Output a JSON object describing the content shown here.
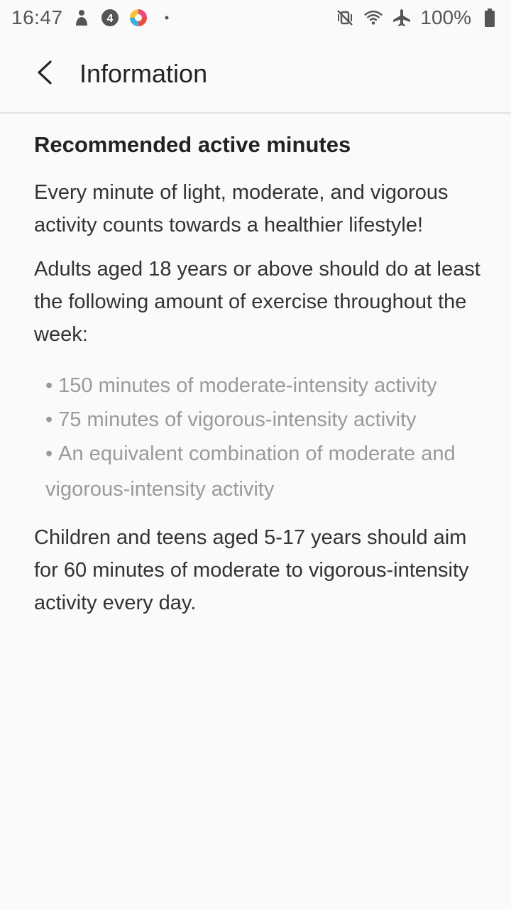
{
  "status_bar": {
    "time": "16:47",
    "battery": "100%",
    "left_icons": [
      "person-icon",
      "badge-4-icon",
      "app-logo-icon",
      "dot-icon"
    ],
    "right_icons": [
      "vibrate-mute-icon",
      "wifi-icon",
      "airplane-icon",
      "battery-icon"
    ]
  },
  "app_bar": {
    "title": "Information"
  },
  "content": {
    "heading": "Recommended active minutes",
    "intro": "Every minute of light, moderate, and vigorous activity counts towards a healthier lifestyle!",
    "adults": "Adults aged 18 years or above should do at least the following amount of exercise throughout the week:",
    "bullets": [
      "150 minutes of moderate-intensity activity",
      "75 minutes of vigorous-intensity activity",
      "An equivalent combination of moderate and vigorous-intensity activity"
    ],
    "children": "Children and teens aged 5-17 years should aim for 60 minutes of moderate to vigorous-intensity activity every day."
  },
  "colors": {
    "background": "#fafafa",
    "text_primary": "#222222",
    "text_body": "#333333",
    "text_muted": "#9a9a9a",
    "divider": "#e3e3e3"
  }
}
